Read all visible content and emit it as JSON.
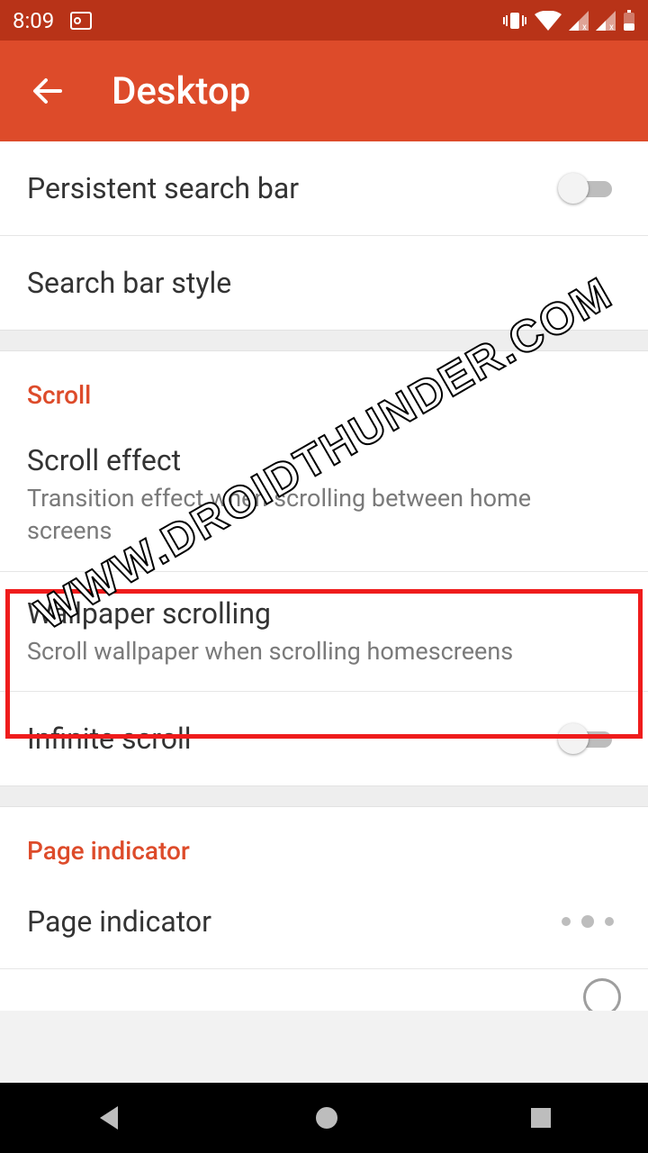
{
  "status": {
    "time": "8:09"
  },
  "header": {
    "title": "Desktop"
  },
  "rows": {
    "persistent_search_bar": {
      "title": "Persistent search bar"
    },
    "search_bar_style": {
      "title": "Search bar style"
    },
    "scroll_header": "Scroll",
    "scroll_effect": {
      "title": "Scroll effect",
      "sub": "Transition effect when scrolling between home screens"
    },
    "wallpaper_scrolling": {
      "title": "Wallpaper scrolling",
      "sub": "Scroll wallpaper when scrolling homescreens"
    },
    "infinite_scroll": {
      "title": "Infinite scroll"
    },
    "page_indicator_header": "Page indicator",
    "page_indicator": {
      "title": "Page indicator"
    }
  },
  "toggles": {
    "persistent_search_bar": false,
    "infinite_scroll": false
  },
  "watermark": "WWW.DROIDTHUNDER.COM",
  "colors": {
    "status_bar": "#b83318",
    "app_bar": "#dd4b2a",
    "accent": "#dd4b2a",
    "highlight_border": "#ef1c1c"
  }
}
